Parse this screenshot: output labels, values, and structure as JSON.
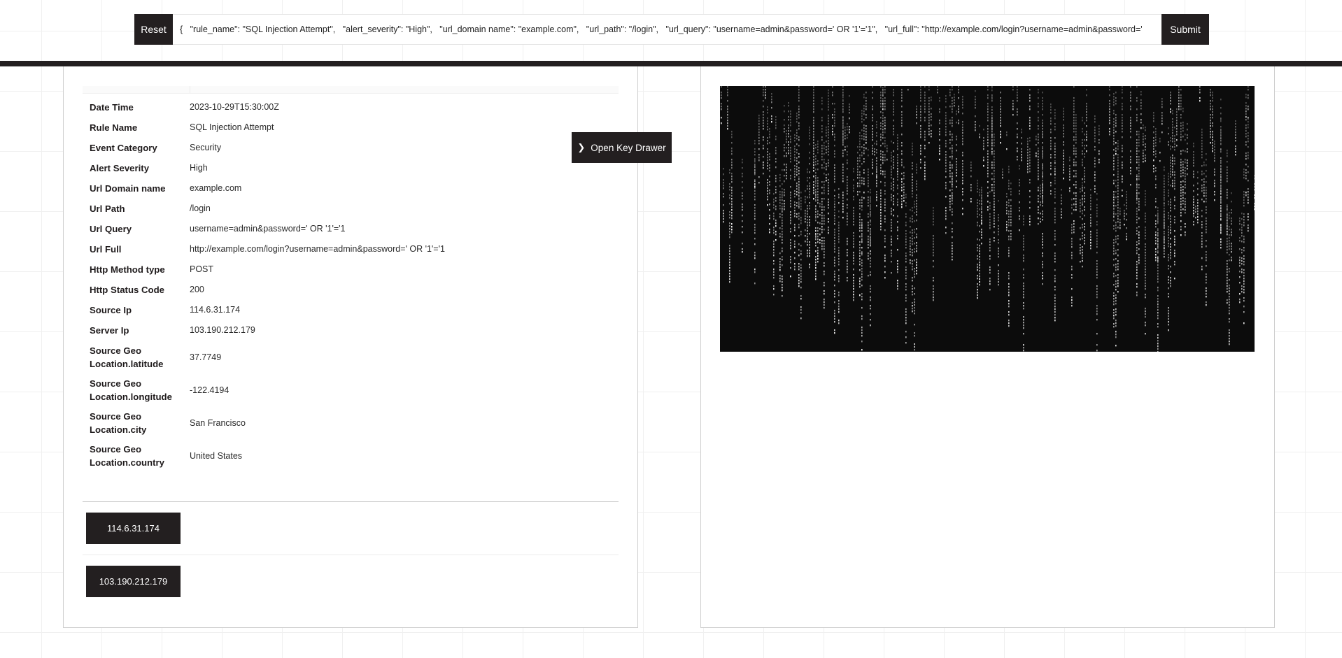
{
  "toolbar": {
    "reset_label": "Reset",
    "submit_label": "Submit",
    "query_value": "{   \"rule_name\": \"SQL Injection Attempt\",   \"alert_severity\": \"High\",   \"url_domain name\": \"example.com\",   \"url_path\": \"/login\",   \"url_query\": \"username=admin&password=' OR '1'='1\",   \"url_full\": \"http://example.com/login?username=admin&password='"
  },
  "drawer": {
    "button_label": "Open Key Drawer",
    "icon": "chevron-right-icon"
  },
  "details": [
    {
      "label": "Date Time",
      "value": "2023-10-29T15:30:00Z"
    },
    {
      "label": "Rule Name",
      "value": "SQL Injection Attempt"
    },
    {
      "label": "Event Category",
      "value": "Security"
    },
    {
      "label": "Alert Severity",
      "value": "High"
    },
    {
      "label": "Url Domain name",
      "value": "example.com"
    },
    {
      "label": "Url Path",
      "value": "/login"
    },
    {
      "label": "Url Query",
      "value": "username=admin&password=' OR '1'='1"
    },
    {
      "label": "Url Full",
      "value": "http://example.com/login?username=admin&password=' OR '1'='1"
    },
    {
      "label": "Http Method type",
      "value": "POST"
    },
    {
      "label": "Http Status Code",
      "value": "200"
    },
    {
      "label": "Source Ip",
      "value": "114.6.31.174"
    },
    {
      "label": "Server Ip",
      "value": "103.190.212.179"
    },
    {
      "label": "Source Geo Location.latitude",
      "value": "37.7749"
    },
    {
      "label": "Source Geo Location.longitude",
      "value": "-122.4194"
    },
    {
      "label": "Source Geo Location.city",
      "value": "San Francisco"
    },
    {
      "label": "Source Geo Location.country",
      "value": "United States"
    }
  ],
  "ip_buttons": [
    {
      "label": "114.6.31.174"
    },
    {
      "label": "103.190.212.179"
    }
  ],
  "colors": {
    "dark": "#231f20",
    "matrix_bg": "#0c0c0c"
  }
}
